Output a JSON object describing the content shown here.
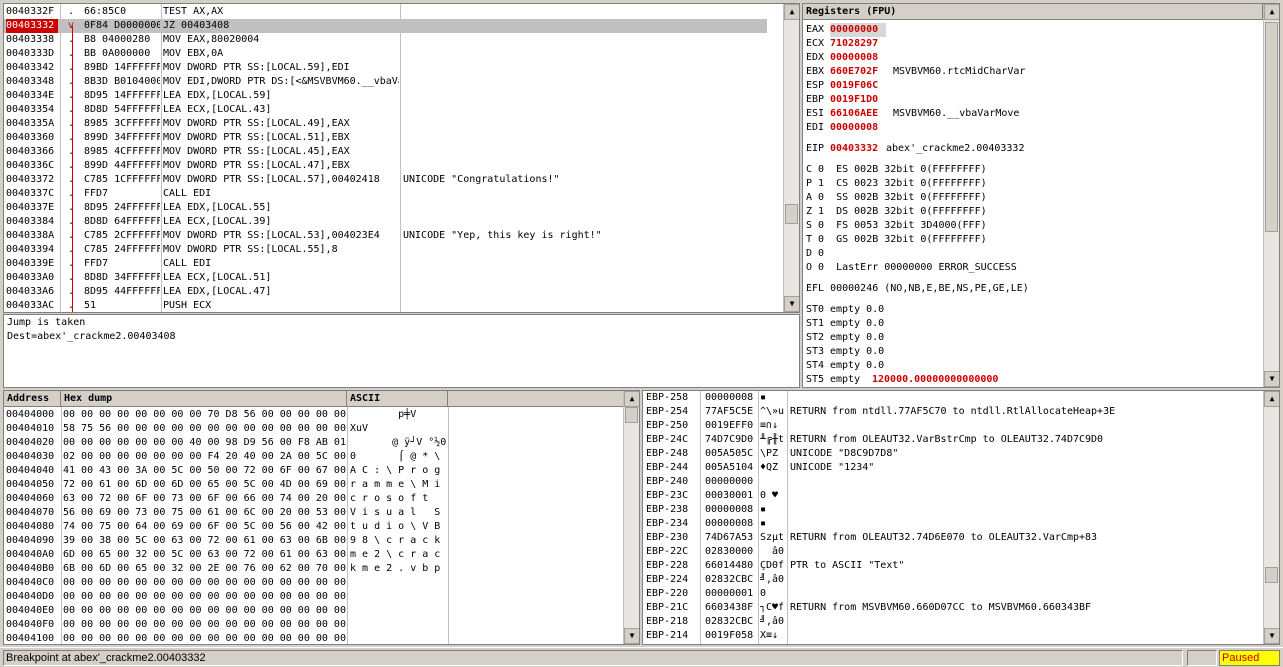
{
  "disassembly": {
    "rows": [
      {
        "addr": "0040332F",
        "mark": ".",
        "hex": "66:85C0",
        "asm": "TEST AX,AX",
        "comment": ""
      },
      {
        "addr": "00403332",
        "mark": "v",
        "hex": "0F84 D0000000",
        "asm": "JZ 00403408",
        "comment": "",
        "current": true
      },
      {
        "addr": "00403338",
        "mark": ".",
        "hex": "B8 04000280",
        "asm": "MOV EAX,80020004",
        "comment": ""
      },
      {
        "addr": "0040333D",
        "mark": ".",
        "hex": "BB 0A000000",
        "asm": "MOV EBX,0A",
        "comment": ""
      },
      {
        "addr": "00403342",
        "mark": ".",
        "hex": "89BD 14FFFFFF",
        "asm": "MOV DWORD PTR SS:[LOCAL.59],EDI",
        "comment": ""
      },
      {
        "addr": "00403348",
        "mark": ".",
        "hex": "8B3D B0104000",
        "asm": "MOV EDI,DWORD PTR DS:[<&MSVBVM60.__vbaVa",
        "comment": ""
      },
      {
        "addr": "0040334E",
        "mark": ".",
        "hex": "8D95 14FFFFFF",
        "asm": "LEA EDX,[LOCAL.59]",
        "comment": ""
      },
      {
        "addr": "00403354",
        "mark": ".",
        "hex": "8D8D 54FFFFFF",
        "asm": "LEA ECX,[LOCAL.43]",
        "comment": ""
      },
      {
        "addr": "0040335A",
        "mark": ".",
        "hex": "8985 3CFFFFFF",
        "asm": "MOV DWORD PTR SS:[LOCAL.49],EAX",
        "comment": ""
      },
      {
        "addr": "00403360",
        "mark": ".",
        "hex": "899D 34FFFFFF",
        "asm": "MOV DWORD PTR SS:[LOCAL.51],EBX",
        "comment": ""
      },
      {
        "addr": "00403366",
        "mark": ".",
        "hex": "8985 4CFFFFFF",
        "asm": "MOV DWORD PTR SS:[LOCAL.45],EAX",
        "comment": ""
      },
      {
        "addr": "0040336C",
        "mark": ".",
        "hex": "899D 44FFFFFF",
        "asm": "MOV DWORD PTR SS:[LOCAL.47],EBX",
        "comment": ""
      },
      {
        "addr": "00403372",
        "mark": ".",
        "hex": "C785 1CFFFFFF",
        "asm": "MOV DWORD PTR SS:[LOCAL.57],00402418",
        "comment": "UNICODE \"Congratulations!\""
      },
      {
        "addr": "0040337C",
        "mark": ".",
        "hex": "FFD7",
        "asm": "CALL EDI",
        "comment": ""
      },
      {
        "addr": "0040337E",
        "mark": ".",
        "hex": "8D95 24FFFFFF",
        "asm": "LEA EDX,[LOCAL.55]",
        "comment": ""
      },
      {
        "addr": "00403384",
        "mark": ".",
        "hex": "8D8D 64FFFFFF",
        "asm": "LEA ECX,[LOCAL.39]",
        "comment": ""
      },
      {
        "addr": "0040338A",
        "mark": ".",
        "hex": "C785 2CFFFFFF",
        "asm": "MOV DWORD PTR SS:[LOCAL.53],004023E4",
        "comment": "UNICODE \"Yep, this key is right!\""
      },
      {
        "addr": "00403394",
        "mark": ".",
        "hex": "C785 24FFFFFF",
        "asm": "MOV DWORD PTR SS:[LOCAL.55],8",
        "comment": ""
      },
      {
        "addr": "0040339E",
        "mark": ".",
        "hex": "FFD7",
        "asm": "CALL EDI",
        "comment": ""
      },
      {
        "addr": "004033A0",
        "mark": ".",
        "hex": "8D8D 34FFFFFF",
        "asm": "LEA ECX,[LOCAL.51]",
        "comment": ""
      },
      {
        "addr": "004033A6",
        "mark": ".",
        "hex": "8D95 44FFFFFF",
        "asm": "LEA EDX,[LOCAL.47]",
        "comment": ""
      },
      {
        "addr": "004033AC",
        "mark": ".",
        "hex": "51",
        "asm": "PUSH ECX",
        "comment": ""
      }
    ]
  },
  "info": {
    "line1": "Jump is taken",
    "line2": "Dest=abex'_crackme2.00403408"
  },
  "registers": {
    "title": "Registers (FPU)",
    "gpr": [
      {
        "name": "EAX",
        "value": "00000000",
        "comment": ""
      },
      {
        "name": "ECX",
        "value": "71028297",
        "comment": ""
      },
      {
        "name": "EDX",
        "value": "00000008",
        "comment": ""
      },
      {
        "name": "EBX",
        "value": "660E702F",
        "comment": "MSVBVM60.rtcMidCharVar"
      },
      {
        "name": "ESP",
        "value": "0019F06C",
        "comment": ""
      },
      {
        "name": "EBP",
        "value": "0019F1D0",
        "comment": ""
      },
      {
        "name": "ESI",
        "value": "66106AEE",
        "comment": "MSVBVM60.__vbaVarMove"
      },
      {
        "name": "EDI",
        "value": "00000008",
        "comment": ""
      }
    ],
    "eip": {
      "name": "EIP",
      "value": "00403332",
      "comment": "abex'_crackme2.00403332"
    },
    "flags": [
      "C 0  ES 002B 32bit 0(FFFFFFFF)",
      "P 1  CS 0023 32bit 0(FFFFFFFF)",
      "A 0  SS 002B 32bit 0(FFFFFFFF)",
      "Z 1  DS 002B 32bit 0(FFFFFFFF)",
      "S 0  FS 0053 32bit 3D4000(FFF)",
      "T 0  GS 002B 32bit 0(FFFFFFFF)",
      "D 0",
      "O 0  LastErr 00000000 ERROR_SUCCESS"
    ],
    "efl": "EFL 00000246 (NO,NB,E,BE,NS,PE,GE,LE)",
    "fpu": [
      {
        "name": "ST0",
        "text": "empty 0.0",
        "highlight": ""
      },
      {
        "name": "ST1",
        "text": "empty 0.0",
        "highlight": ""
      },
      {
        "name": "ST2",
        "text": "empty 0.0",
        "highlight": ""
      },
      {
        "name": "ST3",
        "text": "empty 0.0",
        "highlight": ""
      },
      {
        "name": "ST4",
        "text": "empty 0.0",
        "highlight": ""
      },
      {
        "name": "ST5",
        "text": "empty ",
        "highlight": "120000.00000000000000"
      }
    ]
  },
  "dump": {
    "headers": {
      "address": "Address",
      "hex": "Hex dump",
      "ascii": "ASCII"
    },
    "rows": [
      {
        "addr": "00404000",
        "hex": "00 00 00 00 00 00 00 00 70 D8 56 00 00 00 00 00",
        "ascii": "        p╪V     "
      },
      {
        "addr": "00404010",
        "hex": "58 75 56 00 00 00 00 00 00 00 00 00 00 00 00 00",
        "ascii": "XuV             "
      },
      {
        "addr": "00404020",
        "hex": "00 00 00 00 00 00 00 40 00 98 D9 56 00 F8 AB 01 66",
        "ascii": "       @ ÿ┘V °½0f"
      },
      {
        "addr": "00404030",
        "hex": "02 00 00 00 00 00 00 00 F4 20 40 00 2A 00 5C 00",
        "ascii": "0       ⌠ @ * \\ "
      },
      {
        "addr": "00404040",
        "hex": "41 00 43 00 3A 00 5C 00 50 00 72 00 6F 00 67 00",
        "ascii": "A C : \\ P r o g "
      },
      {
        "addr": "00404050",
        "hex": "72 00 61 00 6D 00 6D 00 65 00 5C 00 4D 00 69 00",
        "ascii": "r a m m e \\ M i "
      },
      {
        "addr": "00404060",
        "hex": "63 00 72 00 6F 00 73 00 6F 00 66 00 74 00 20 00",
        "ascii": "c r o s o f t   "
      },
      {
        "addr": "00404070",
        "hex": "56 00 69 00 73 00 75 00 61 00 6C 00 20 00 53 00",
        "ascii": "V i s u a l   S "
      },
      {
        "addr": "00404080",
        "hex": "74 00 75 00 64 00 69 00 6F 00 5C 00 56 00 42 00",
        "ascii": "t u d i o \\ V B "
      },
      {
        "addr": "00404090",
        "hex": "39 00 38 00 5C 00 63 00 72 00 61 00 63 00 6B 00",
        "ascii": "9 8 \\ c r a c k "
      },
      {
        "addr": "004040A0",
        "hex": "6D 00 65 00 32 00 5C 00 63 00 72 00 61 00 63 00",
        "ascii": "m e 2 \\ c r a c "
      },
      {
        "addr": "004040B0",
        "hex": "6B 00 6D 00 65 00 32 00 2E 00 76 00 62 00 70 00",
        "ascii": "k m e 2 . v b p "
      },
      {
        "addr": "004040C0",
        "hex": "00 00 00 00 00 00 00 00 00 00 00 00 00 00 00 00",
        "ascii": ""
      },
      {
        "addr": "004040D0",
        "hex": "00 00 00 00 00 00 00 00 00 00 00 00 00 00 00 00",
        "ascii": ""
      },
      {
        "addr": "004040E0",
        "hex": "00 00 00 00 00 00 00 00 00 00 00 00 00 00 00 00",
        "ascii": ""
      },
      {
        "addr": "004040F0",
        "hex": "00 00 00 00 00 00 00 00 00 00 00 00 00 00 00 00",
        "ascii": ""
      },
      {
        "addr": "00404100",
        "hex": "00 00 00 00 00 00 00 00 00 00 00 00 00 00 00 00",
        "ascii": ""
      }
    ]
  },
  "stack": {
    "rows": [
      {
        "off": "EBP-258",
        "val": "00000008",
        "chr": "▪",
        "comment": ""
      },
      {
        "off": "EBP-254",
        "val": "77AF5C5E",
        "chr": "^\\»u",
        "comment": "RETURN from ntdll.77AF5C70 to ntdll.RtlAllocateHeap+3E"
      },
      {
        "off": "EBP-250",
        "val": "0019EFF0",
        "chr": "≡∩↓",
        "comment": ""
      },
      {
        "off": "EBP-24C",
        "val": "74D7C9D0",
        "chr": "╨╔╫t",
        "comment": "RETURN from OLEAUT32.VarBstrCmp to OLEAUT32.74D7C9D0"
      },
      {
        "off": "EBP-248",
        "val": "005A505C",
        "chr": "\\PZ",
        "comment": "UNICODE \"D8C9D7D8\""
      },
      {
        "off": "EBP-244",
        "val": "005A5104",
        "chr": "♦QZ",
        "comment": "UNICODE \"1234\""
      },
      {
        "off": "EBP-240",
        "val": "00000000",
        "chr": "",
        "comment": ""
      },
      {
        "off": "EBP-23C",
        "val": "00030001",
        "chr": "0 ♥",
        "comment": ""
      },
      {
        "off": "EBP-238",
        "val": "00000008",
        "chr": "▪",
        "comment": ""
      },
      {
        "off": "EBP-234",
        "val": "00000008",
        "chr": "▪",
        "comment": ""
      },
      {
        "off": "EBP-230",
        "val": "74D67A53",
        "chr": "Szμt",
        "comment": "RETURN from OLEAUT32.74D6E070 to OLEAUT32.VarCmp+83"
      },
      {
        "off": "EBP-22C",
        "val": "02830000",
        "chr": "  â0",
        "comment": ""
      },
      {
        "off": "EBP-228",
        "val": "66014480",
        "chr": "ÇD0f",
        "comment": "PTR to ASCII \"Text\""
      },
      {
        "off": "EBP-224",
        "val": "02832CBC",
        "chr": "╝,â0",
        "comment": ""
      },
      {
        "off": "EBP-220",
        "val": "00000001",
        "chr": "0",
        "comment": ""
      },
      {
        "off": "EBP-21C",
        "val": "6603438F",
        "chr": "┐C♥f",
        "comment": "RETURN from MSVBVM60.660D07CC to MSVBVM60.660343BF"
      },
      {
        "off": "EBP-218",
        "val": "02832CBC",
        "chr": "╝,â0",
        "comment": ""
      },
      {
        "off": "EBP-214",
        "val": "0019F058",
        "chr": "X≡↓",
        "comment": ""
      }
    ]
  },
  "status": {
    "message": "Breakpoint at abex'_crackme2.00403332",
    "state": "Paused"
  },
  "colors": {
    "accent_red": "#cc0000",
    "status_yellow": "#ffff00",
    "chrome": "#d4d0c8"
  }
}
